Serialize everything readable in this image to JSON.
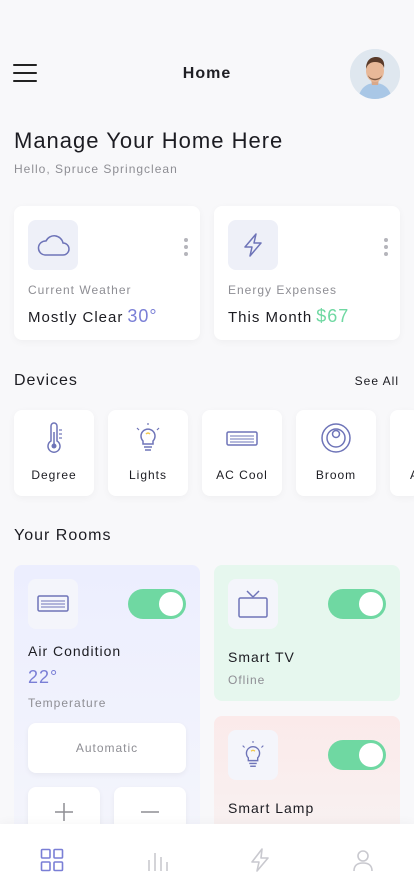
{
  "header": {
    "title": "Home",
    "menu_icon": "menu-icon",
    "avatar": "user-avatar"
  },
  "intro": {
    "title": "Manage Your Home Here",
    "greeting": "Hello, Spruce Springclean"
  },
  "summary_cards": [
    {
      "icon": "cloud-icon",
      "label": "Current Weather",
      "value": "Mostly Clear",
      "accent": "30°",
      "accent_color": "#7a7fd6"
    },
    {
      "icon": "lightning-icon",
      "label": "Energy Expenses",
      "value": "This Month",
      "accent": "$67",
      "accent_color": "#6fd8a2"
    }
  ],
  "devices": {
    "title": "Devices",
    "see_all": "See All",
    "items": [
      {
        "label": "Degree",
        "icon": "thermometer-icon"
      },
      {
        "label": "Lights",
        "icon": "lightbulb-icon"
      },
      {
        "label": "AC Cool",
        "icon": "air-conditioner-icon"
      },
      {
        "label": "Broom",
        "icon": "robot-vacuum-icon"
      },
      {
        "label": "A",
        "icon": "partial-device-icon"
      }
    ]
  },
  "rooms": {
    "title": "Your Rooms",
    "items": [
      {
        "name": "Air Condition",
        "temperature": "22°",
        "subtitle": "Temperature",
        "mode": "Automatic",
        "enabled": true,
        "icon": "air-conditioner-icon",
        "color": "#eceefe"
      },
      {
        "name": "Smart TV",
        "subtitle": "Ofline",
        "enabled": true,
        "icon": "tv-icon",
        "color": "#e6f7ee"
      },
      {
        "name": "Smart Lamp",
        "enabled": true,
        "icon": "lightbulb-icon",
        "color": "#fbeaea"
      }
    ]
  },
  "colors": {
    "accent_purple": "#7a7fd6",
    "accent_green": "#6fd8a2",
    "icon_stroke": "#6e74b8"
  },
  "tabs": [
    {
      "name": "dashboard-icon",
      "active": true
    },
    {
      "name": "stats-icon",
      "active": false
    },
    {
      "name": "energy-icon",
      "active": false
    },
    {
      "name": "profile-icon",
      "active": false
    }
  ]
}
